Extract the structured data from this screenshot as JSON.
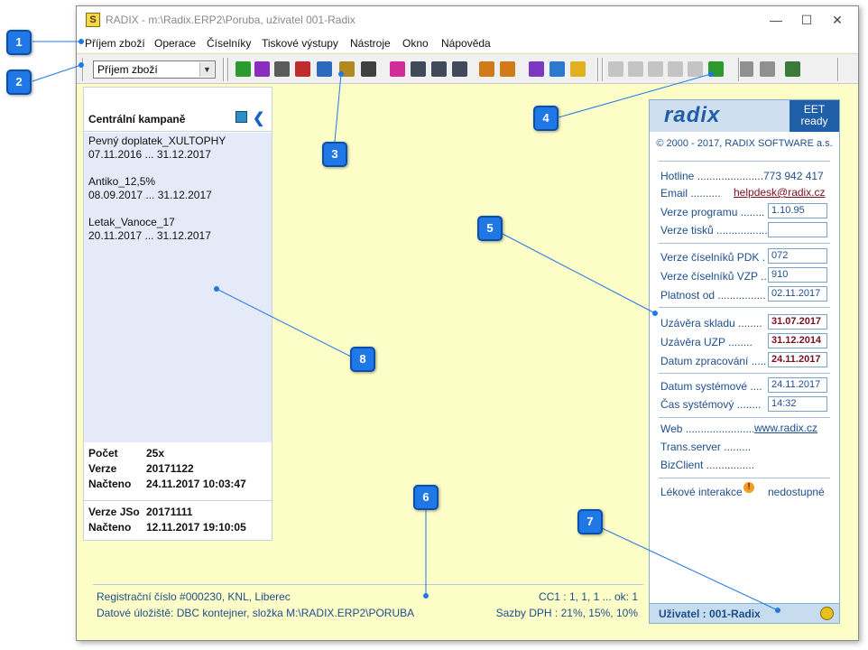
{
  "window": {
    "title": "RADIX - m:\\Radix.ERP2\\Poruba, uživatel 001-Radix",
    "app_icon_glyph": "S",
    "min_label": "—",
    "max_label": "☐",
    "close_label": "✕"
  },
  "menu": {
    "items": [
      "Příjem zboží",
      "Operace",
      "Číselníky",
      "Tiskové výstupy",
      "Nástroje",
      "Okno",
      "Nápověda"
    ]
  },
  "toolbar": {
    "module_select": "Příjem zboží",
    "icons": [
      {
        "name": "table-add-icon",
        "color": "#2c9a2c"
      },
      {
        "name": "table-edit-icon",
        "color": "#8a2cc0"
      },
      {
        "name": "truck-icon",
        "color": "#5a5a5a"
      },
      {
        "name": "table-delete-icon",
        "color": "#c02c2c"
      },
      {
        "name": "table-search-icon",
        "color": "#2c6ac0"
      },
      {
        "name": "thumb-icon",
        "color": "#b08a20"
      },
      {
        "name": "arrows-icon",
        "color": "#404040"
      },
      {
        "name": "pink-doc-icon",
        "color": "#d02c9a"
      },
      {
        "name": "form-icon",
        "color": "#404a5a"
      },
      {
        "name": "check-form-icon",
        "color": "#404a5a"
      },
      {
        "name": "edit-form-icon",
        "color": "#404a5a"
      },
      {
        "name": "export-icon",
        "color": "#d07a1a"
      },
      {
        "name": "import-icon",
        "color": "#d07a1a"
      },
      {
        "name": "network-icon",
        "color": "#7a3ac0"
      },
      {
        "name": "globe-icon",
        "color": "#2c7ad0"
      },
      {
        "name": "note-icon",
        "color": "#e0b020"
      },
      {
        "name": "new-doc-icon",
        "color": "#c4c4c4"
      },
      {
        "name": "forward-icon",
        "color": "#c4c4c4"
      },
      {
        "name": "delete-icon",
        "color": "#c4c4c4"
      },
      {
        "name": "save-icon",
        "color": "#c4c4c4"
      },
      {
        "name": "undo-icon",
        "color": "#c4c4c4"
      },
      {
        "name": "refresh-icon",
        "color": "#2c9a2c"
      },
      {
        "name": "import-box-icon",
        "color": "#909090"
      },
      {
        "name": "print-icon",
        "color": "#909090"
      },
      {
        "name": "users-icon",
        "color": "#3a7a3a"
      }
    ]
  },
  "left_panel": {
    "title": "Centrální kampaně",
    "campaigns": [
      {
        "name": "Pevný doplatek_XULTOPHY",
        "period": "07.11.2016 ... 31.12.2017"
      },
      {
        "name": "Antiko_12,5%",
        "period": "08.09.2017 ... 31.12.2017"
      },
      {
        "name": "Letak_Vanoce_17",
        "period": "20.11.2017 ... 31.12.2017"
      }
    ],
    "stats": [
      {
        "label": "Počet",
        "value": "25x"
      },
      {
        "label": "Verze",
        "value": "20171122"
      },
      {
        "label": "Načteno",
        "value": "24.11.2017 10:03:47"
      }
    ],
    "stats2": [
      {
        "label": "Verze JSo",
        "value": "20171111"
      },
      {
        "label": "Načteno",
        "value": "12.11.2017 19:10:05"
      }
    ]
  },
  "status": {
    "registration": "Registrační číslo #000230, KNL, Liberec",
    "storage": "Datové úložiště: DBC kontejner, složka M:\\RADIX.ERP2\\PORUBA",
    "cc1": "CC1 : 1, 1, 1 ... ok: 1",
    "vat": "Sazby DPH : 21%, 15%, 10%"
  },
  "info_panel": {
    "logo": "radix",
    "eet_line1": "EET",
    "eet_line2": "ready",
    "copyright": "© 2000 - 2017, RADIX SOFTWARE a.s.",
    "hotline_label": "Hotline ......................",
    "hotline_value": "773 942 417",
    "email_label": "Email ..........",
    "email_value": "helpdesk@radix.cz",
    "program_label": "Verze programu ........",
    "program_value": "1.10.95",
    "print_label": "Verze tisků .................",
    "print_value": "",
    "pdk_label": "Verze číselníků PDK .",
    "pdk_value": "072",
    "vzp_label": "Verze číselníků VZP ..",
    "vzp_value": "910",
    "validity_label": "Platnost od ................",
    "validity_value": "02.11.2017",
    "stock_close_label": "Uzávěra skladu ........",
    "stock_close_value": "31.07.2017",
    "uzp_close_label": "Uzávěra UZP ........",
    "uzp_close_value": "31.12.2014",
    "processing_label": "Datum zpracování .....",
    "processing_value": "24.11.2017",
    "sysdate_label": "Datum systémové ....",
    "sysdate_value": "24.11.2017",
    "systime_label": "Čas systémový ........",
    "systime_value": "14:32",
    "web_label": "Web .......................",
    "web_value": "www.radix.cz",
    "trans_label": "Trans.server .........",
    "bizclient_label": "BizClient ................",
    "drug_label": "Lékové interakce",
    "drug_value": "nedostupné",
    "user": "Uživatel : 001-Radix"
  },
  "callouts": [
    "1",
    "2",
    "3",
    "4",
    "5",
    "6",
    "7",
    "8"
  ]
}
